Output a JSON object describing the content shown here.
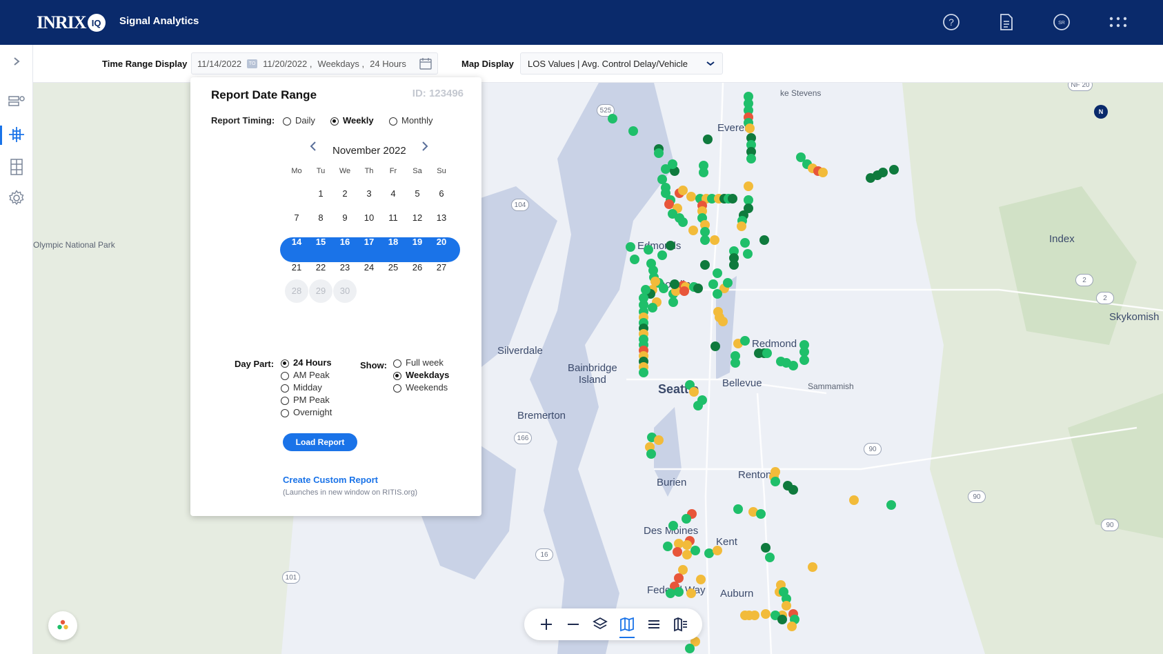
{
  "header": {
    "logo_text": "INRIX",
    "logo_badge": "IQ",
    "app_title": "Signal Analytics",
    "icons": [
      "help-icon",
      "report-icon",
      "user-icon",
      "apps-grid-icon"
    ],
    "user_initials": "SR"
  },
  "toolbar": {
    "time_range_label": "Time Range Display",
    "start_date": "11/14/2022",
    "to_badge": "TO",
    "end_date": "11/20/2022 ,",
    "day_type": "Weekdays ,",
    "day_part": "24 Hours",
    "map_display_label": "Map Display",
    "map_display_value": "LOS Values | Avg. Control Delay/Vehicle"
  },
  "panel": {
    "title": "Report Date Range",
    "report_id": "ID: 123496",
    "timing_label": "Report Timing:",
    "timing_options": [
      "Daily",
      "Weekly",
      "Monthly"
    ],
    "timing_selected": "Weekly",
    "month_label": "November 2022",
    "weekdays": [
      "Mo",
      "Tu",
      "We",
      "Th",
      "Fr",
      "Sa",
      "Su"
    ],
    "weeks": [
      [
        "",
        "1",
        "2",
        "3",
        "4",
        "5",
        "6"
      ],
      [
        "7",
        "8",
        "9",
        "10",
        "11",
        "12",
        "13"
      ],
      [
        "14",
        "15",
        "16",
        "17",
        "18",
        "19",
        "20"
      ],
      [
        "21",
        "22",
        "23",
        "24",
        "25",
        "26",
        "27"
      ],
      [
        "28",
        "29",
        "30",
        "",
        "",
        "",
        ""
      ]
    ],
    "selected_week_index": 2,
    "disabled_days": [
      "28",
      "29",
      "30"
    ],
    "day_part_label": "Day Part:",
    "day_part_options": [
      "24 Hours",
      "AM Peak",
      "Midday",
      "PM Peak",
      "Overnight"
    ],
    "day_part_selected": "24 Hours",
    "show_label": "Show:",
    "show_options": [
      "Full week",
      "Weekdays",
      "Weekends"
    ],
    "show_selected": "Weekdays",
    "load_button": "Load Report",
    "custom_link": "Create Custom Report",
    "custom_note": "(Launches in new window on RITIS.org)"
  },
  "map": {
    "places": {
      "olympic": "Olympic National Park",
      "lake_stevens": "ke Stevens",
      "everett": "Everett",
      "edmonds": "Edmonds",
      "shoreline": "Shoreline",
      "index": "Index",
      "skykomish": "Skykomish",
      "silverdale": "Silverdale",
      "bainbridge": "Bainbridge\nIsland",
      "redmond": "Redmond",
      "seattle": "Seattle",
      "bellevue": "Bellevue",
      "sammamish": "Sammamish",
      "bremerton": "Bremerton",
      "renton": "Renton",
      "burien": "Burien",
      "des_moines": "Des Moines",
      "kent": "Kent",
      "federal_way": "Federal Way",
      "auburn": "Auburn"
    },
    "shields": [
      "525",
      "104",
      "166",
      "16",
      "101",
      "2",
      "2",
      "90",
      "90",
      "90",
      "NF 20"
    ],
    "north_label": "N",
    "los_colors": {
      "good": "#1fbf6a",
      "dark": "#0f7a3d",
      "moderate": "#f2bb3a",
      "poor": "#e8563a"
    }
  },
  "map_tools": [
    "zoom-in-icon",
    "zoom-out-icon",
    "layers-icon",
    "map-icon",
    "list-icon",
    "map-legend-icon"
  ]
}
